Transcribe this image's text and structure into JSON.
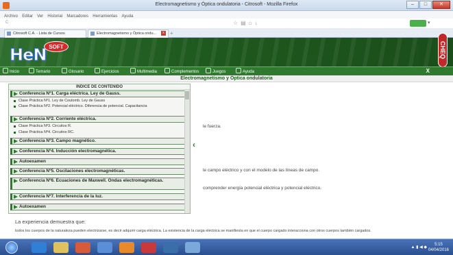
{
  "window": {
    "title": "Electromagnetismo y Óptica ondulatoria - Citrosoft - Mozilla Firefox",
    "buttons": [
      "–",
      "□",
      "✕"
    ]
  },
  "menubar": {
    "items": [
      "Archivo",
      "Editar",
      "Ver",
      "Historial",
      "Marcadores",
      "Herramientas",
      "Ayuda"
    ]
  },
  "navbar": {
    "address": "C"
  },
  "tabs": [
    {
      "label": "Citrosoft C.A. - Lista de Cursos"
    },
    {
      "label": "Electromagnetismo y Óptica ondu..."
    }
  ],
  "tab_add": "+",
  "site": {
    "logo_text": "HeN",
    "logo_badge": "SOFT",
    "side_tab_label": "CHEQ",
    "close_label": "X",
    "nav": [
      {
        "label": "Inicio",
        "icon": "home-icon"
      },
      {
        "label": "Temario",
        "icon": "list-icon"
      },
      {
        "label": "Glosario",
        "icon": "book-icon"
      },
      {
        "label": "Ejercicios",
        "icon": "pencil-icon"
      },
      {
        "label": "Multimedia",
        "icon": "media-icon"
      },
      {
        "label": "Complementos",
        "icon": "plus-icon"
      },
      {
        "label": "Juegos",
        "icon": "game-icon"
      },
      {
        "label": "Ayuda",
        "icon": "help-icon"
      }
    ],
    "page_title": "Electromagnetismo y Óptica ondulatoria"
  },
  "toc": {
    "title": "INDICE DE CONTENIDO",
    "items": [
      {
        "type": "conf",
        "label": "Conferencia Nº1. Carga eléctrica. Ley de Gauss."
      },
      {
        "type": "sub",
        "label": "Clase Práctica Nº1. Ley de Coulomb. Ley de Gauss"
      },
      {
        "type": "sub",
        "label": "Clase Práctica Nº2. Potencial eléctrico. Diferencia de potencial. Capacitancia"
      },
      {
        "type": "conf",
        "label": "Conferencia Nº2. Corriente eléctrica."
      },
      {
        "type": "sub",
        "label": "Clase Práctica Nº3. Circuitos R."
      },
      {
        "type": "sub",
        "label": "Clase Práctica Nº4. Circuitos RC."
      },
      {
        "type": "conf",
        "label": "Conferencia Nº3. Campo magnético."
      },
      {
        "type": "conf",
        "label": "Conferencia Nº4. Inducción electromagnética."
      },
      {
        "type": "conf",
        "label": "Autoexamen"
      },
      {
        "type": "conf",
        "label": "Conferencia Nº5. Oscilaciones electromagnéticas."
      },
      {
        "type": "conf",
        "label": "Conferencia Nº6. Ecuaciones de Maxwell. Ondas electromagnéticas."
      },
      {
        "type": "conf",
        "label": "Conferencia Nº7. Interferencia de la luz."
      },
      {
        "type": "conf",
        "label": "Autoexamen"
      }
    ]
  },
  "content": {
    "fragment_1": "le fuerza.",
    "fragment_2": "le campo eléctrico y con el modelo de las líneas de campo.",
    "fragment_3": "comprender energía potencial eléctrica y potencial eléctrico.",
    "heading": "La experiencia demuestra que:",
    "paragraph": "todos los cuerpos de la naturaleza pueden electrizarse, es decir adquirir carga eléctrica. La existencia de la carga eléctrica se manifiesta en que el cuerpo cargado interacciona con otros cuerpos también cargados."
  },
  "taskbar": {
    "time": "5:15",
    "date": "04/04/2016"
  }
}
